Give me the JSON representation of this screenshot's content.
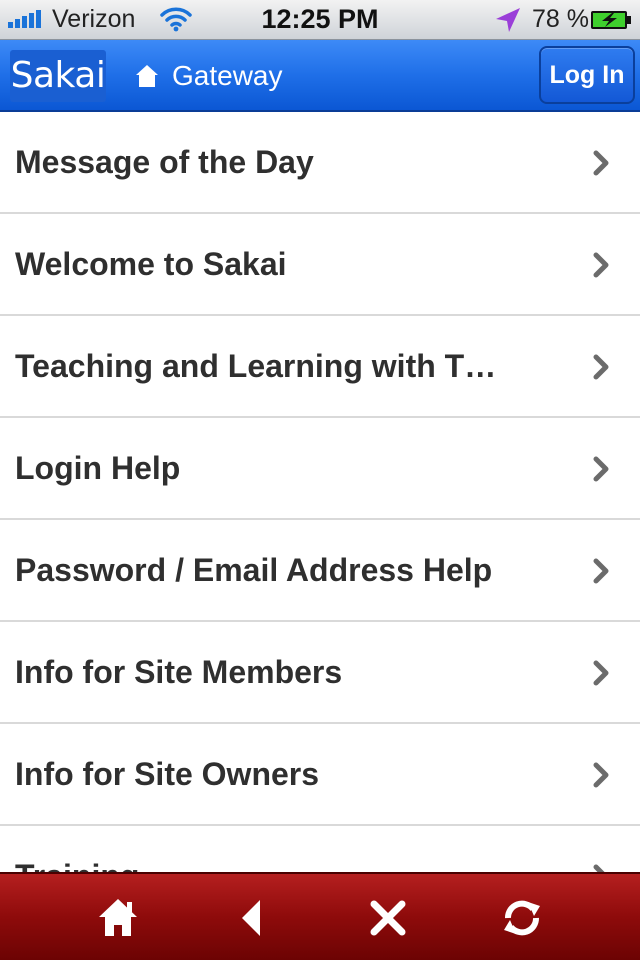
{
  "status_bar": {
    "carrier": "Verizon",
    "time": "12:25 PM",
    "battery_percent": "78 %",
    "icons": [
      "signal-bars-icon",
      "wifi-icon",
      "location-arrow-icon",
      "battery-charging-icon"
    ]
  },
  "header": {
    "logo": "Sakai",
    "title": "Gateway",
    "login_label": "Log In",
    "icon": "home-icon"
  },
  "list": {
    "items": [
      {
        "label": "Message of the Day"
      },
      {
        "label": "Welcome to Sakai"
      },
      {
        "label": "Teaching and Learning with T…"
      },
      {
        "label": "Login Help"
      },
      {
        "label": "Password / Email Address Help"
      },
      {
        "label": "Info for Site Members"
      },
      {
        "label": "Info for Site Owners"
      },
      {
        "label": "Training"
      }
    ],
    "item_icon": "chevron-right-icon"
  },
  "toolbar": {
    "icons": [
      "home-icon",
      "back-arrow-icon",
      "close-icon",
      "refresh-icon"
    ]
  },
  "colors": {
    "header_blue": "#1f6fe8",
    "toolbar_red": "#8e0b0b",
    "text_dark": "#2f2f2f",
    "divider": "#d9d9d9"
  }
}
